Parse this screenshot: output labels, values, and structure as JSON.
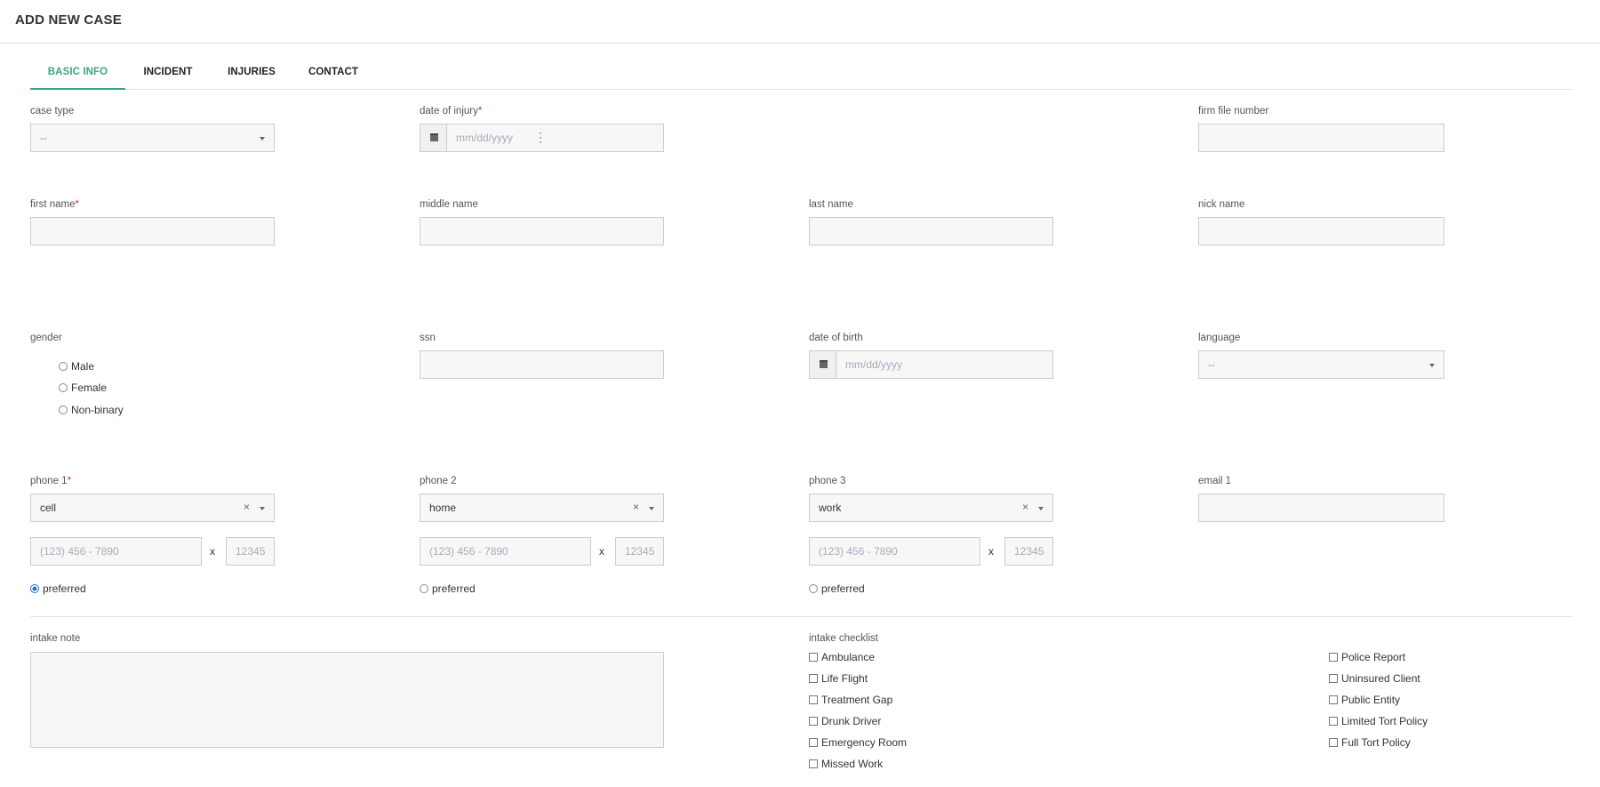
{
  "page": {
    "title": "ADD NEW CASE"
  },
  "tabs": [
    {
      "label": "BASIC INFO"
    },
    {
      "label": "INCIDENT"
    },
    {
      "label": "INJURIES"
    },
    {
      "label": "CONTACT"
    }
  ],
  "form": {
    "case_type": {
      "label": "case type",
      "value": "--"
    },
    "date_of_injury": {
      "label": "date of injury",
      "placeholder": "mm/dd/yyyy",
      "required_mark": "*"
    },
    "firm_file_number": {
      "label": "firm file number",
      "value": ""
    },
    "first_name": {
      "label": "first name",
      "required_mark": "*"
    },
    "middle_name": {
      "label": "middle name"
    },
    "last_name": {
      "label": "last name"
    },
    "nick_name": {
      "label": "nick name"
    },
    "gender": {
      "label": "gender",
      "options": [
        "Male",
        "Female",
        "Non-binary"
      ]
    },
    "ssn": {
      "label": "ssn"
    },
    "date_of_birth": {
      "label": "date of birth",
      "placeholder": "mm/dd/yyyy"
    },
    "language": {
      "label": "language",
      "value": "--"
    },
    "phone1": {
      "label": "phone 1",
      "required_mark": "*",
      "type": "cell",
      "number_placeholder": "(123) 456 - 7890",
      "ext_placeholder": "12345",
      "ext_sep": "x",
      "preferred_label": "preferred",
      "preferred": true
    },
    "phone2": {
      "label": "phone 2",
      "type": "home",
      "number_placeholder": "(123) 456 - 7890",
      "ext_placeholder": "12345",
      "ext_sep": "x",
      "preferred_label": "preferred",
      "preferred": false
    },
    "phone3": {
      "label": "phone 3",
      "type": "work",
      "number_placeholder": "(123) 456 - 7890",
      "ext_placeholder": "12345",
      "ext_sep": "x",
      "preferred_label": "preferred",
      "preferred": false
    },
    "email1": {
      "label": "email 1"
    },
    "clear_symbol": "×",
    "intake_note": {
      "label": "intake note"
    },
    "intake_checklist": {
      "label": "intake checklist",
      "left": [
        "Ambulance",
        "Life Flight",
        "Treatment Gap",
        "Drunk Driver",
        "Emergency Room",
        "Missed Work"
      ],
      "right": [
        "Police Report",
        "Uninsured Client",
        "Public Entity",
        "Limited Tort Policy",
        "Full Tort Policy"
      ]
    }
  },
  "colors": {
    "accent": "#3aa876",
    "required": "#c0392b",
    "radio_selected": "#1e6fd9"
  }
}
